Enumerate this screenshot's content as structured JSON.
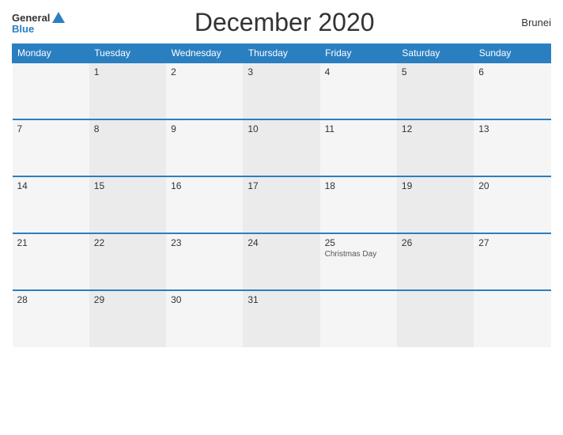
{
  "header": {
    "logo_general": "General",
    "logo_blue": "Blue",
    "title": "December 2020",
    "country": "Brunei"
  },
  "weekdays": [
    "Monday",
    "Tuesday",
    "Wednesday",
    "Thursday",
    "Friday",
    "Saturday",
    "Sunday"
  ],
  "weeks": [
    [
      {
        "day": "",
        "empty": true
      },
      {
        "day": "1"
      },
      {
        "day": "2"
      },
      {
        "day": "3"
      },
      {
        "day": "4"
      },
      {
        "day": "5"
      },
      {
        "day": "6"
      }
    ],
    [
      {
        "day": "7"
      },
      {
        "day": "8"
      },
      {
        "day": "9"
      },
      {
        "day": "10"
      },
      {
        "day": "11"
      },
      {
        "day": "12"
      },
      {
        "day": "13"
      }
    ],
    [
      {
        "day": "14"
      },
      {
        "day": "15"
      },
      {
        "day": "16"
      },
      {
        "day": "17"
      },
      {
        "day": "18"
      },
      {
        "day": "19"
      },
      {
        "day": "20"
      }
    ],
    [
      {
        "day": "21"
      },
      {
        "day": "22"
      },
      {
        "day": "23"
      },
      {
        "day": "24"
      },
      {
        "day": "25",
        "event": "Christmas Day"
      },
      {
        "day": "26"
      },
      {
        "day": "27"
      }
    ],
    [
      {
        "day": "28"
      },
      {
        "day": "29"
      },
      {
        "day": "30"
      },
      {
        "day": "31"
      },
      {
        "day": ""
      },
      {
        "day": ""
      },
      {
        "day": ""
      }
    ]
  ]
}
